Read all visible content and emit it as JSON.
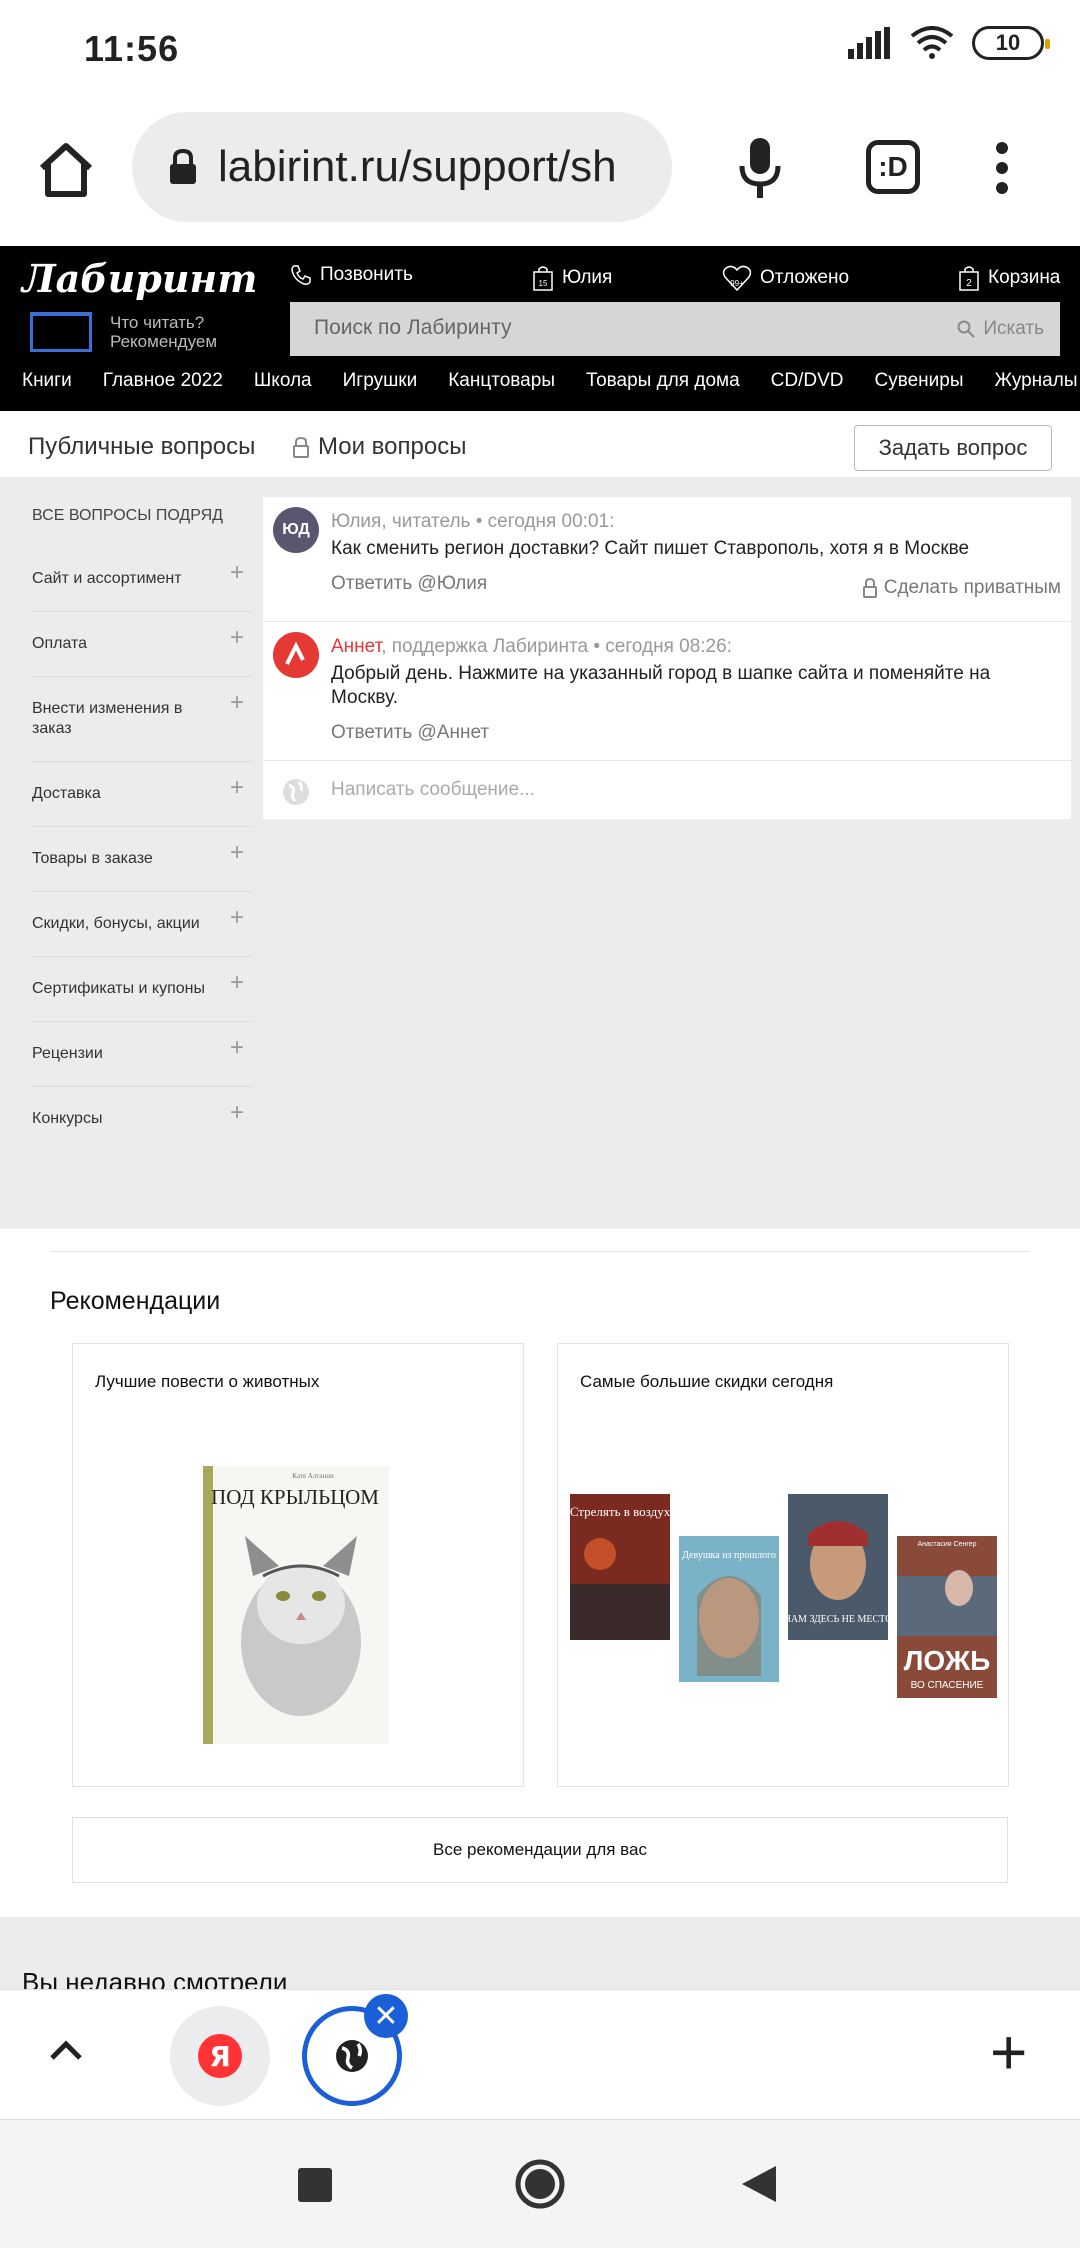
{
  "status_bar": {
    "time": "11:56",
    "battery": "10"
  },
  "browser": {
    "url": "labirint.ru/support/sh",
    "tabs_count_label": ":D"
  },
  "site": {
    "logo": "Лабиринт",
    "read_line1": "Что читать?",
    "read_line2": "Рекомендуем",
    "call": "Позвонить",
    "user": "Юлия",
    "user_badge": "15",
    "postponed": "Отложено",
    "postponed_badge": "99+",
    "cart": "Корзина",
    "cart_badge": "2",
    "search_placeholder": "Поиск по Лабиринту",
    "search_button": "Искать",
    "nav": [
      "Книги",
      "Главное 2022",
      "Школа",
      "Игрушки",
      "Канцтовары",
      "Товары для дома",
      "CD/DVD",
      "Сувениры",
      "Журналы"
    ]
  },
  "support": {
    "tab_public": "Публичные вопросы",
    "tab_mine": "Мои вопросы",
    "ask_button": "Задать вопрос",
    "all_questions": "Все вопросы подряд",
    "categories": [
      "Сайт и ассортимент",
      "Оплата",
      "Внести изменения в заказ",
      "Доставка",
      "Товары в заказе",
      "Скидки, бонусы, акции",
      "Сертификаты и купоны",
      "Рецензии",
      "Конкурсы"
    ]
  },
  "thread": {
    "q_avatar": "ЮД",
    "q_meta": "Юлия, читатель • сегодня 00:01:",
    "q_text": "Как сменить регион доставки? Сайт пишет Ставрополь, хотя я в Москве",
    "q_reply": "Ответить @Юлия",
    "q_private": "Сделать приватным",
    "a_author": "Аннет",
    "a_meta": ", поддержка Лабиринта • сегодня 08:26:",
    "a_text": "Добрый день. Нажмите на указанный город в шапке сайта и поменяйте на Москву.",
    "a_reply": "Ответить @Аннет",
    "compose_placeholder": "Написать сообщение..."
  },
  "recommendations": {
    "title": "Рекомендации",
    "card1_title": "Лучшие повести о животных",
    "card2_title": "Самые большие скидки сегодня",
    "all_link": "Все рекомендации для вас",
    "book1_title": "ПОД КРЫЛЬЦОМ",
    "book1_author": "Катя Алтанни",
    "book2_title": "Стрелять в воздух",
    "book3_title": "Девушка из прошлого",
    "book4_title": "НАМ ЗДЕСЬ НЕ МЕСТО",
    "book5_title": "ЛОЖЬ",
    "book5_subtitle": "ВО СПАСЕНИЕ",
    "book5_author": "Анастасия Сенгер"
  },
  "recent": {
    "title": "Вы недавно смотрели"
  },
  "colors": {
    "accent": "#e53935",
    "header_bg": "#000000",
    "tab_ring": "#1a5fd8"
  }
}
